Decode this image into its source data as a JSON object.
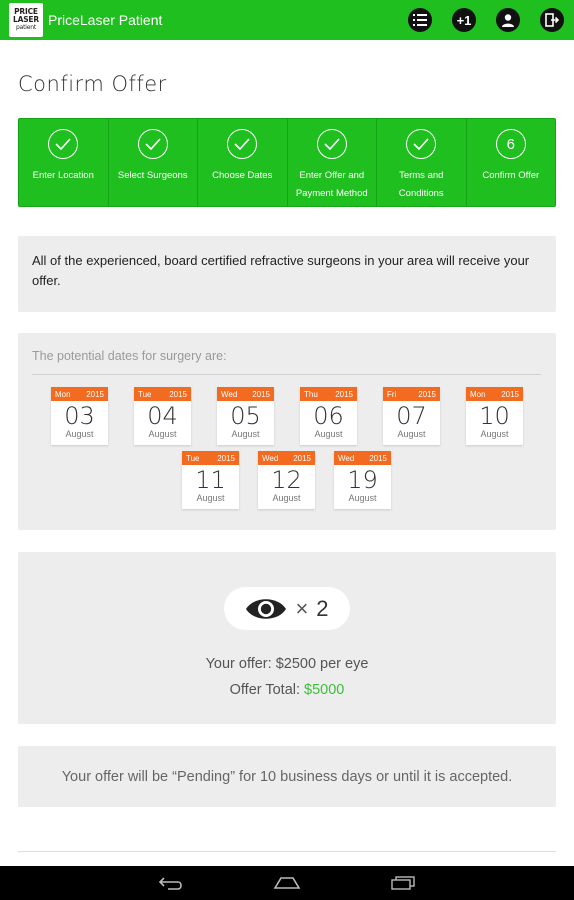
{
  "app": {
    "logo_lines": [
      "PRICE",
      "LASER",
      "patient"
    ],
    "title": "PriceLaser Patient"
  },
  "toolbar": {
    "actions": [
      {
        "name": "list-icon"
      },
      {
        "name": "plus-one-icon",
        "label": "+1"
      },
      {
        "name": "account-icon"
      },
      {
        "name": "logout-icon"
      }
    ]
  },
  "page": {
    "title": "Confirm Offer"
  },
  "steps": [
    {
      "label": "Enter Location",
      "state": "done"
    },
    {
      "label": "Select Surgeons",
      "state": "done"
    },
    {
      "label": "Choose Dates",
      "state": "done"
    },
    {
      "label": "Enter Offer and Payment Method",
      "state": "done"
    },
    {
      "label": "Terms and Conditions",
      "state": "done"
    },
    {
      "label": "Confirm Offer",
      "number": "6",
      "state": "current"
    }
  ],
  "info": {
    "text": "All of the experienced, board certified refractive surgeons in your area will receive your offer."
  },
  "dates": {
    "title": "The potential dates for surgery are:",
    "items": [
      {
        "weekday": "Mon",
        "year": "2015",
        "day": "03",
        "month": "August"
      },
      {
        "weekday": "Tue",
        "year": "2015",
        "day": "04",
        "month": "August"
      },
      {
        "weekday": "Wed",
        "year": "2015",
        "day": "05",
        "month": "August"
      },
      {
        "weekday": "Thu",
        "year": "2015",
        "day": "06",
        "month": "August"
      },
      {
        "weekday": "Fri",
        "year": "2015",
        "day": "07",
        "month": "August"
      },
      {
        "weekday": "Mon",
        "year": "2015",
        "day": "10",
        "month": "August"
      },
      {
        "weekday": "Tue",
        "year": "2015",
        "day": "11",
        "month": "August"
      },
      {
        "weekday": "Wed",
        "year": "2015",
        "day": "12",
        "month": "August"
      },
      {
        "weekday": "Wed",
        "year": "2015",
        "day": "19",
        "month": "August"
      }
    ]
  },
  "offer": {
    "times_symbol": "×",
    "eye_count": "2",
    "per_eye_text": "Your offer: $2500 per eye",
    "total_label": "Offer Total: ",
    "total_value": "$5000"
  },
  "pending": {
    "text": "Your offer will be “Pending” for 10 business days or until it is accepted."
  },
  "colors": {
    "brand_green": "#1fbf1f",
    "calendar_orange": "#f26b21",
    "total_green": "#3bbf3b"
  }
}
